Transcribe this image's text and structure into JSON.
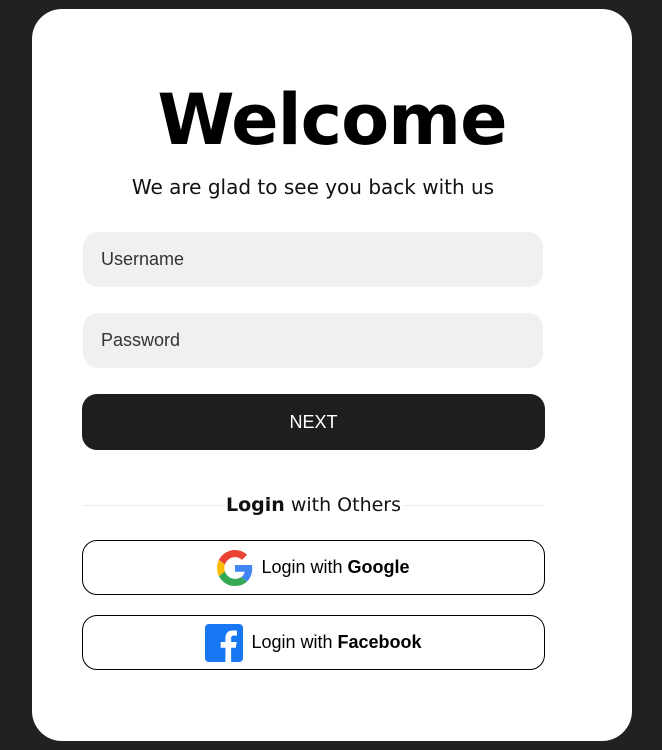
{
  "header": {
    "title": "Welcome",
    "subtitle": "We are glad to see you back with us"
  },
  "form": {
    "username_placeholder": "Username",
    "password_placeholder": "Password",
    "next_label": "NEXT"
  },
  "divider": {
    "bold": "Login",
    "rest": " with Others"
  },
  "social": {
    "google": {
      "prefix": "Login with ",
      "provider": "Google",
      "icon": "google-icon"
    },
    "facebook": {
      "prefix": "Login with ",
      "provider": "Facebook",
      "icon": "facebook-icon"
    }
  },
  "colors": {
    "background": "#212121",
    "card": "#ffffff",
    "input_bg": "#f0f0f0",
    "button": "#1e1e1e",
    "facebook_blue": "#1877f2"
  }
}
